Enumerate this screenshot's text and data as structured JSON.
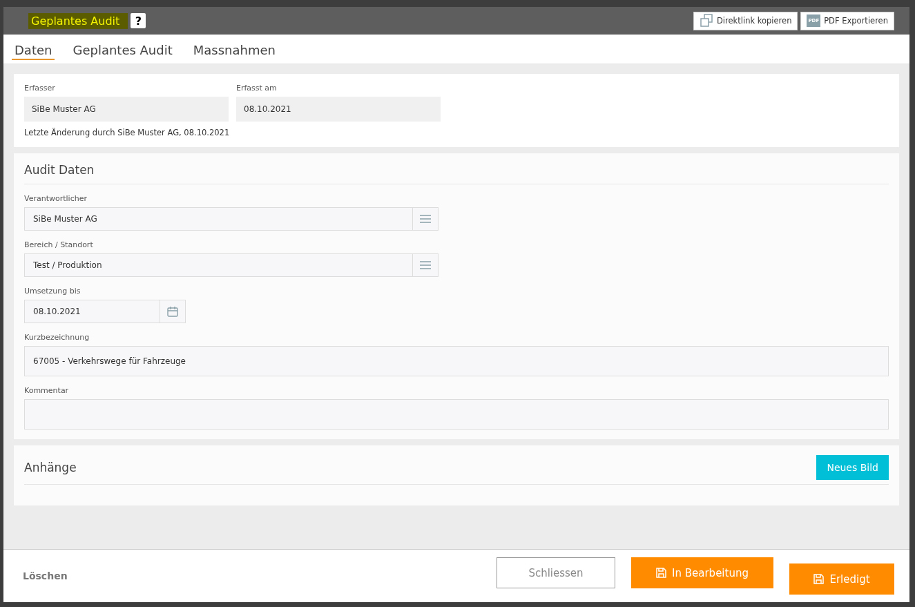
{
  "window": {
    "title": "Geplantes Audit",
    "help": "?"
  },
  "header_buttons": [
    {
      "label": "Direktlink kopieren",
      "kind": "copy"
    },
    {
      "label": "PDF Exportieren",
      "kind": "pdf",
      "icon_text": "PDF"
    }
  ],
  "tabs": [
    {
      "label": "Daten",
      "selected": true
    },
    {
      "label": "Geplantes Audit",
      "selected": false
    },
    {
      "label": "Massnahmen",
      "selected": false
    }
  ],
  "meta": {
    "fields": [
      {
        "label": "Erfasser",
        "value": "SiBe Muster AG"
      },
      {
        "label": "Erfasst am",
        "value": "08.10.2021"
      }
    ],
    "last_change": "Letzte Änderung durch SiBe Muster AG, 08.10.2021"
  },
  "audit_data": {
    "title": "Audit Daten",
    "fields": [
      {
        "label": "Verantwortlicher",
        "value": "SiBe Muster AG",
        "kind": "select"
      },
      {
        "label": "Bereich / Standort",
        "value": "Test / Produktion",
        "kind": "select"
      },
      {
        "label": "Umsetzung bis",
        "value": "08.10.2021",
        "kind": "date"
      },
      {
        "label": "Kurzbezeichnung",
        "value": "67005 - Verkehrswege für Fahrzeuge",
        "kind": "text"
      },
      {
        "label": "Kommentar",
        "kind": "textarea"
      }
    ]
  },
  "attachments": {
    "title": "Anhänge",
    "button": "Neues Bild"
  },
  "footer": {
    "delete": "Löschen",
    "buttons": [
      {
        "label": "Schliessen",
        "kind": "secondary"
      },
      {
        "label": "In Bearbeitung",
        "kind": "save"
      },
      {
        "label": "Erledigt",
        "kind": "save"
      }
    ]
  }
}
